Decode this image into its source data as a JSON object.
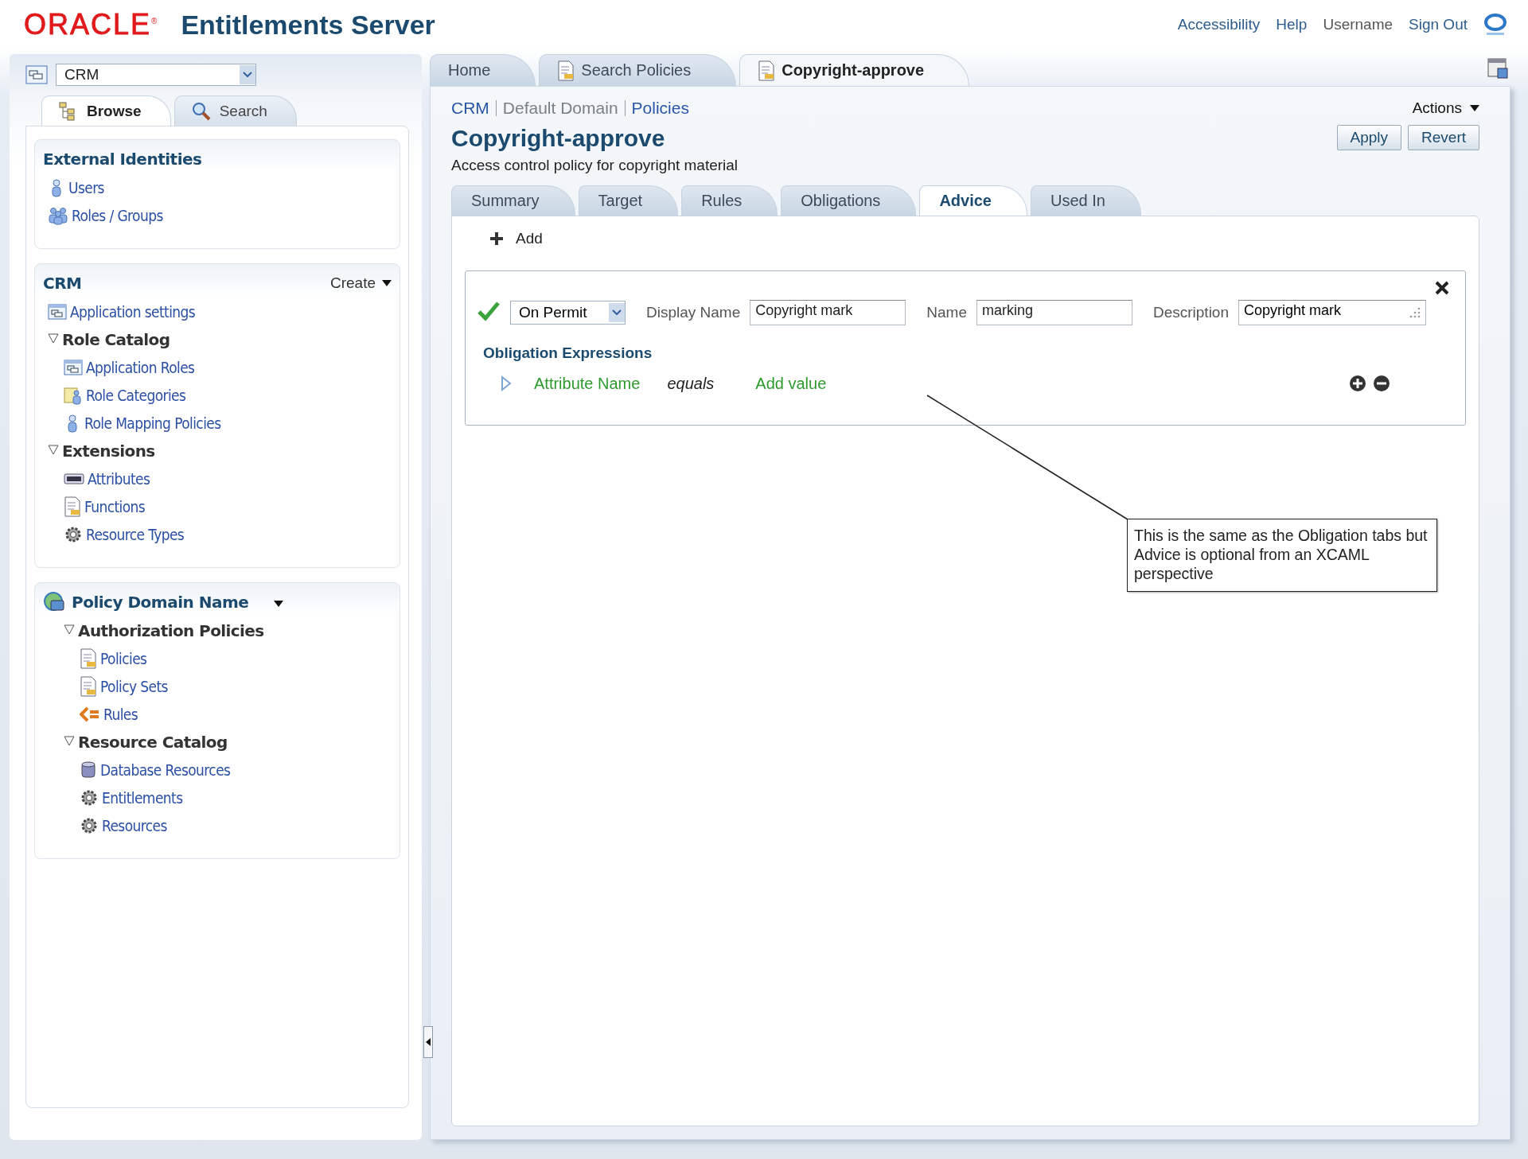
{
  "header": {
    "logo": "ORACLE$^{®}$",
    "title": "Entitlements Server",
    "links": [
      "Accessibility",
      "Help",
      "Username",
      "Sign Out"
    ]
  },
  "navigator": {
    "app_selector": "CRM",
    "tabs": [
      {
        "label": "Browse",
        "selected": true
      },
      {
        "label": "Search",
        "selected": false
      }
    ],
    "sections": [
      {
        "title": "External Identities",
        "items": [
          {
            "label": "Users"
          },
          {
            "label": "Roles / Groups"
          }
        ]
      },
      {
        "title": "CRM",
        "menu": "Create",
        "items": [
          {
            "label": "Application settings"
          },
          {
            "label": "Role Catalog",
            "expanded": true,
            "children": [
              {
                "label": "Application Roles"
              },
              {
                "label": "Role Categories"
              },
              {
                "label": "Role Mapping Policies"
              }
            ]
          },
          {
            "label": "Extensions",
            "expanded": true,
            "children": [
              {
                "label": "Attributes"
              },
              {
                "label": "Functions"
              },
              {
                "label": "Resource Types"
              }
            ]
          }
        ]
      },
      {
        "title": "Policy Domain Name",
        "has_menu": true,
        "items": [
          {
            "label": "Authorization Policies",
            "expanded": true,
            "children": [
              {
                "label": "Policies"
              },
              {
                "label": "Policy Sets"
              },
              {
                "label": "Rules"
              }
            ]
          },
          {
            "label": "Resource Catalog",
            "expanded": true,
            "children": [
              {
                "label": "Database Resources"
              },
              {
                "label": "Entitlements"
              },
              {
                "label": "Resources"
              }
            ]
          }
        ]
      }
    ]
  },
  "page_tabs": [
    {
      "label": "Home",
      "selected": false
    },
    {
      "label": "Search Policies",
      "selected": false
    },
    {
      "label": "Copyright-approve",
      "selected": true
    }
  ],
  "breadcrumb": [
    {
      "label": "CRM",
      "link": true
    },
    {
      "label": "Default Domain",
      "link": false
    },
    {
      "label": "Policies",
      "link": true
    }
  ],
  "actions_menu": "Actions",
  "title": "Copyright-approve",
  "description": "Access control policy for copyright material",
  "buttons": [
    "Apply",
    "Revert"
  ],
  "policy_tabs": [
    {
      "label": "Summary",
      "selected": false
    },
    {
      "label": "Target",
      "selected": false
    },
    {
      "label": "Rules",
      "selected": false
    },
    {
      "label": "Obligations",
      "selected": false
    },
    {
      "label": "Advice",
      "selected": true
    },
    {
      "label": "Used In",
      "selected": false
    }
  ],
  "add_button": "Add",
  "advice": {
    "enabled": true,
    "effect": "On Permit",
    "fields": [
      {
        "label": "Display Name",
        "value": "Copyright mark",
        "kind": "text"
      },
      {
        "label": "Name",
        "value": "marking",
        "kind": "text"
      },
      {
        "label": "Description",
        "value": "Copyright mark",
        "kind": "textarea"
      }
    ],
    "section_title": "Obligation Expressions",
    "expression": {
      "attribute": "Attribute Name",
      "operator": "equals",
      "value": "Add value"
    }
  },
  "callout": "This is the same as the Obligation tabs but Advice is optional from an XCAML perspective"
}
